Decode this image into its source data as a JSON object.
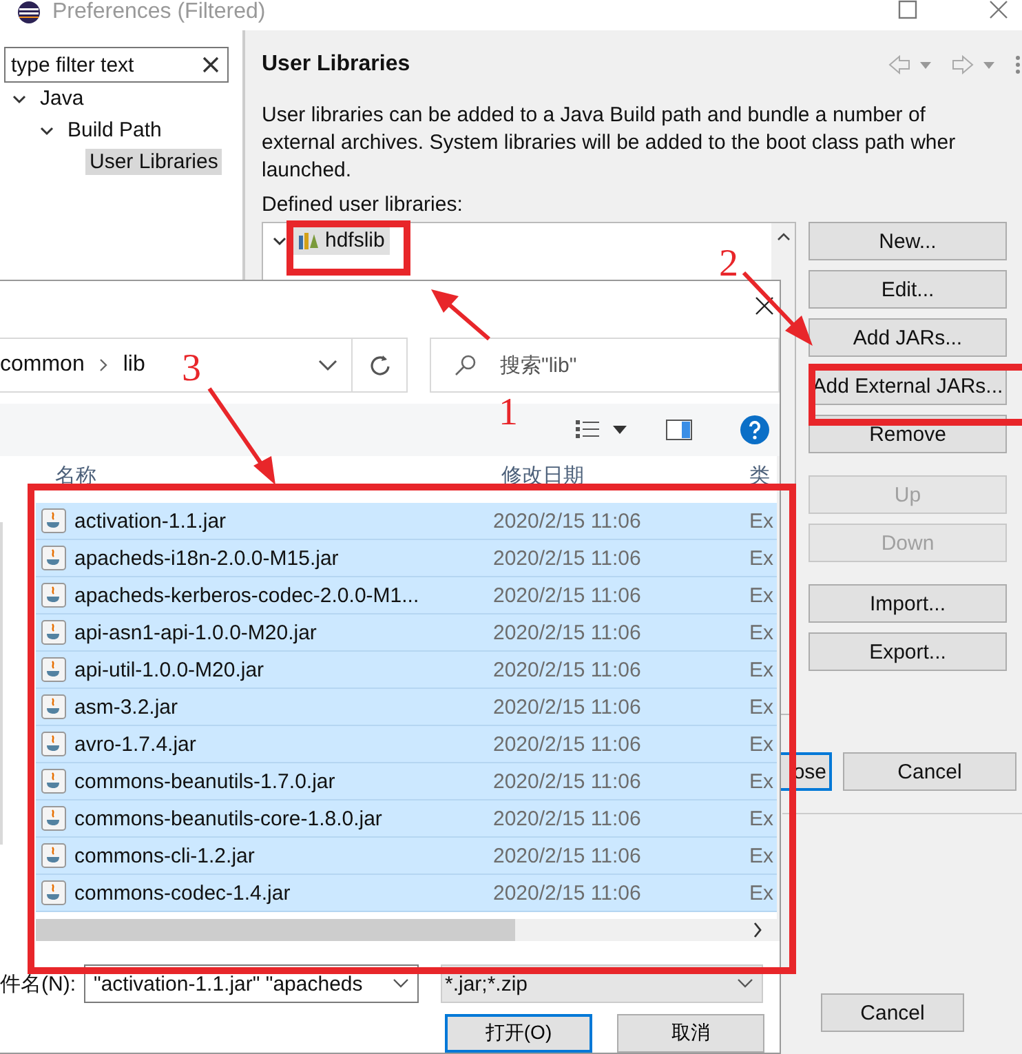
{
  "preferences": {
    "title": "Preferences (Filtered)",
    "filter": {
      "placeholder": "type filter text"
    },
    "tree": [
      {
        "label": "Java",
        "expanded": true,
        "selected": false,
        "children": [
          {
            "label": "Build Path",
            "expanded": true,
            "selected": false,
            "children": [
              {
                "label": "User Libraries",
                "selected": true
              }
            ]
          }
        ]
      }
    ],
    "page_title": "User Libraries",
    "description": [
      "User libraries can be added to a Java Build path and bundle a number of",
      "external archives. System libraries will be added to the boot class path wher",
      "launched."
    ],
    "list_label": "Defined user libraries:",
    "libraries": [
      {
        "name": "hdfslib",
        "expanded": true
      }
    ],
    "buttons": [
      {
        "label": "New...",
        "disabled": false
      },
      {
        "label": "Edit...",
        "disabled": false
      },
      {
        "label": "Add JARs...",
        "disabled": false
      },
      {
        "label": "Add External JARs...",
        "disabled": false
      },
      {
        "label": "Remove",
        "disabled": false
      },
      {
        "label": "Up",
        "disabled": true
      },
      {
        "label": "Down",
        "disabled": true
      },
      {
        "label": "Import...",
        "disabled": false
      },
      {
        "label": "Export...",
        "disabled": false
      }
    ],
    "dialog_buttons": [
      "ose",
      "Cancel"
    ]
  },
  "open_dialog": {
    "breadcrumb": [
      "common",
      "lib"
    ],
    "search": {
      "placeholder": "搜索\"lib\""
    },
    "columns": [
      "名称",
      "修改日期",
      "类"
    ],
    "files": [
      {
        "name": "activation-1.1.jar",
        "date": "2020/2/15 11:06",
        "type": "Ex",
        "selected": true
      },
      {
        "name": "apacheds-i18n-2.0.0-M15.jar",
        "date": "2020/2/15 11:06",
        "type": "Ex",
        "selected": true
      },
      {
        "name": "apacheds-kerberos-codec-2.0.0-M1...",
        "date": "2020/2/15 11:06",
        "type": "Ex",
        "selected": true
      },
      {
        "name": "api-asn1-api-1.0.0-M20.jar",
        "date": "2020/2/15 11:06",
        "type": "Ex",
        "selected": true
      },
      {
        "name": "api-util-1.0.0-M20.jar",
        "date": "2020/2/15 11:06",
        "type": "Ex",
        "selected": true
      },
      {
        "name": "asm-3.2.jar",
        "date": "2020/2/15 11:06",
        "type": "Ex",
        "selected": true
      },
      {
        "name": "avro-1.7.4.jar",
        "date": "2020/2/15 11:06",
        "type": "Ex",
        "selected": true
      },
      {
        "name": "commons-beanutils-1.7.0.jar",
        "date": "2020/2/15 11:06",
        "type": "Ex",
        "selected": true
      },
      {
        "name": "commons-beanutils-core-1.8.0.jar",
        "date": "2020/2/15 11:06",
        "type": "Ex",
        "selected": true
      },
      {
        "name": "commons-cli-1.2.jar",
        "date": "2020/2/15 11:06",
        "type": "Ex",
        "selected": true
      },
      {
        "name": "commons-codec-1.4.jar",
        "date": "2020/2/15 11:06",
        "type": "Ex",
        "selected": true
      }
    ],
    "file_name_label": "件名(N):",
    "file_name": "\"activation-1.1.jar\" \"apacheds",
    "file_type": "*.jar;*.zip",
    "buttons": [
      "打开(O)",
      "取消"
    ]
  },
  "background_window": {
    "buttons": [
      "Cancel"
    ]
  },
  "annotations": [
    {
      "number": "1"
    },
    {
      "number": "2"
    },
    {
      "number": "3"
    }
  ]
}
